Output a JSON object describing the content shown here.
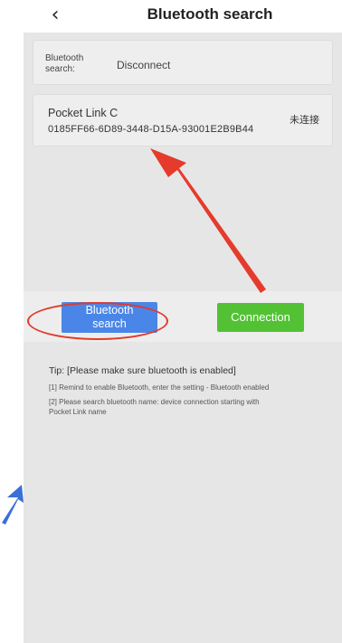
{
  "header": {
    "back_icon": "chevron-left-icon",
    "title": "Bluetooth search"
  },
  "status": {
    "label_line1": "Bluetooth",
    "label_line2": "search:",
    "value": "Disconnect"
  },
  "device": {
    "name": "Pocket Link C",
    "id": "0185FF66-6D89-3448-D15A-93001E2B9B44",
    "state": "未连接"
  },
  "buttons": {
    "search_line1": "Bluetooth",
    "search_line2": "search",
    "connect": "Connection"
  },
  "tips": {
    "title": "Tip: [Please make sure bluetooth is enabled]",
    "line1": "[1] Remind to enable Bluetooth, enter the setting - Bluetooth enabled",
    "line2a": "[2] Please search bluetooth name: device connection starting with",
    "line2b": "Pocket Link name"
  },
  "colors": {
    "search_button": "#4a86e8",
    "connect_button": "#52c234",
    "annotation": "#e23a2a",
    "panel": "#e6e6e6"
  }
}
